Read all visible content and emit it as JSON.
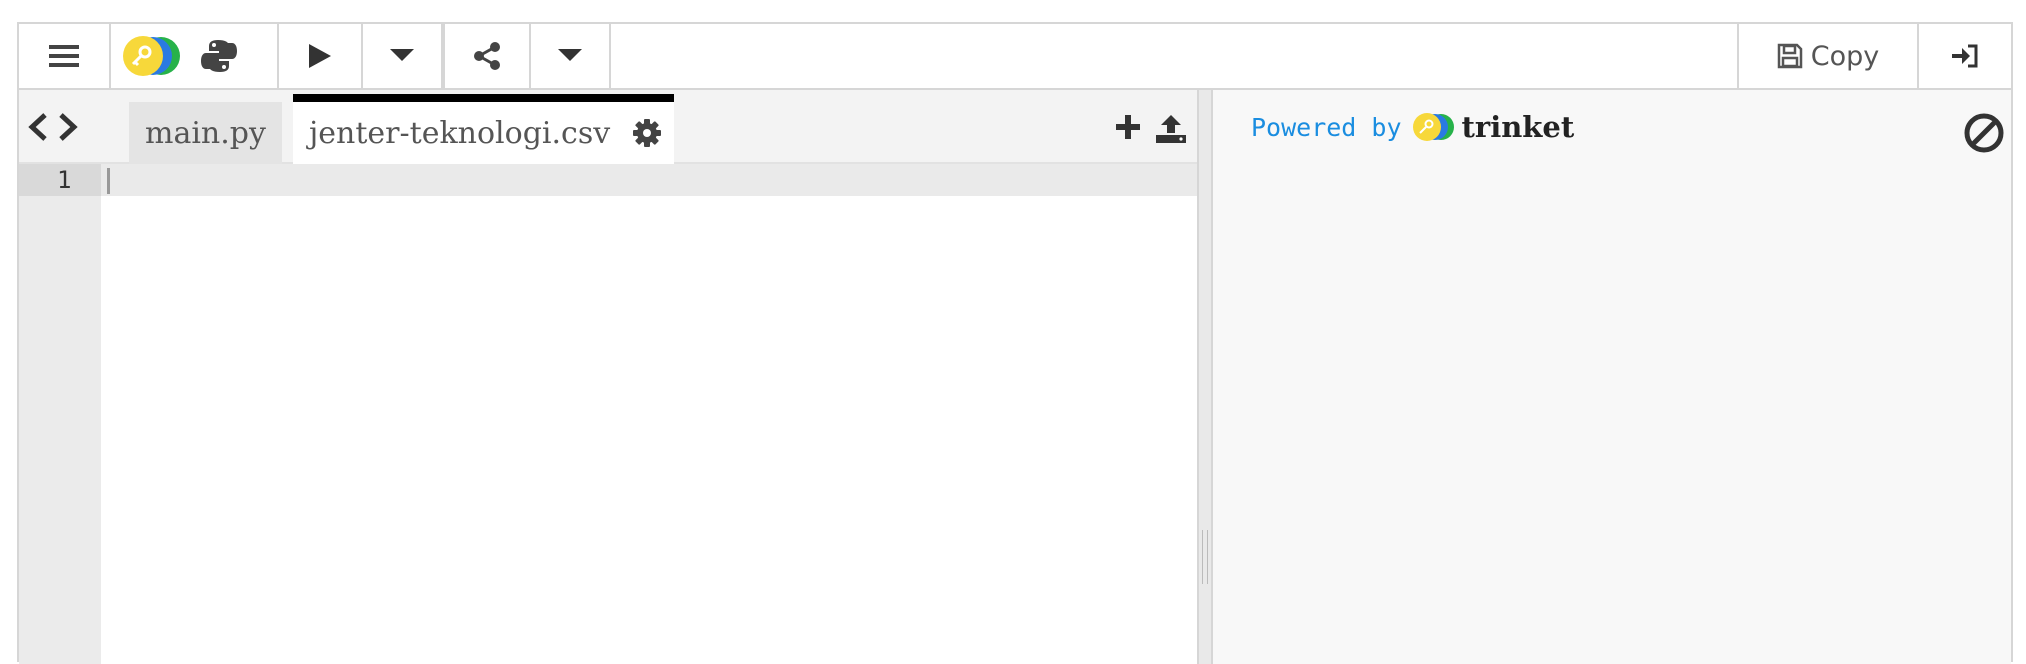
{
  "toolbar": {
    "copy_label": "Copy"
  },
  "editor": {
    "tabs": [
      {
        "label": "main.py",
        "active": false
      },
      {
        "label": "jenter-teknologi.csv",
        "active": true
      }
    ],
    "line_numbers": [
      "1"
    ]
  },
  "output": {
    "powered_by": "Powered by",
    "brand": "trinket"
  },
  "colors": {
    "accent_blue": "#1a8de0",
    "logo_yellow": "#f7d83a",
    "logo_blue": "#2a7ae2",
    "logo_green": "#27b24a",
    "active_tab_border": "#000000"
  },
  "icons": {
    "menu": "hamburger-menu-icon",
    "logo": "trinket-logo-icon",
    "python": "python-icon",
    "run": "play-icon",
    "run_menu": "caret-down-icon",
    "share": "share-icon",
    "share_menu": "caret-down-icon",
    "copy": "floppy-disk-icon",
    "login": "sign-in-icon",
    "code_nav": "chevron-left-right-icon",
    "tab_settings": "gear-icon",
    "add_file": "plus-icon",
    "upload": "upload-icon",
    "clear_output": "ban-icon"
  }
}
